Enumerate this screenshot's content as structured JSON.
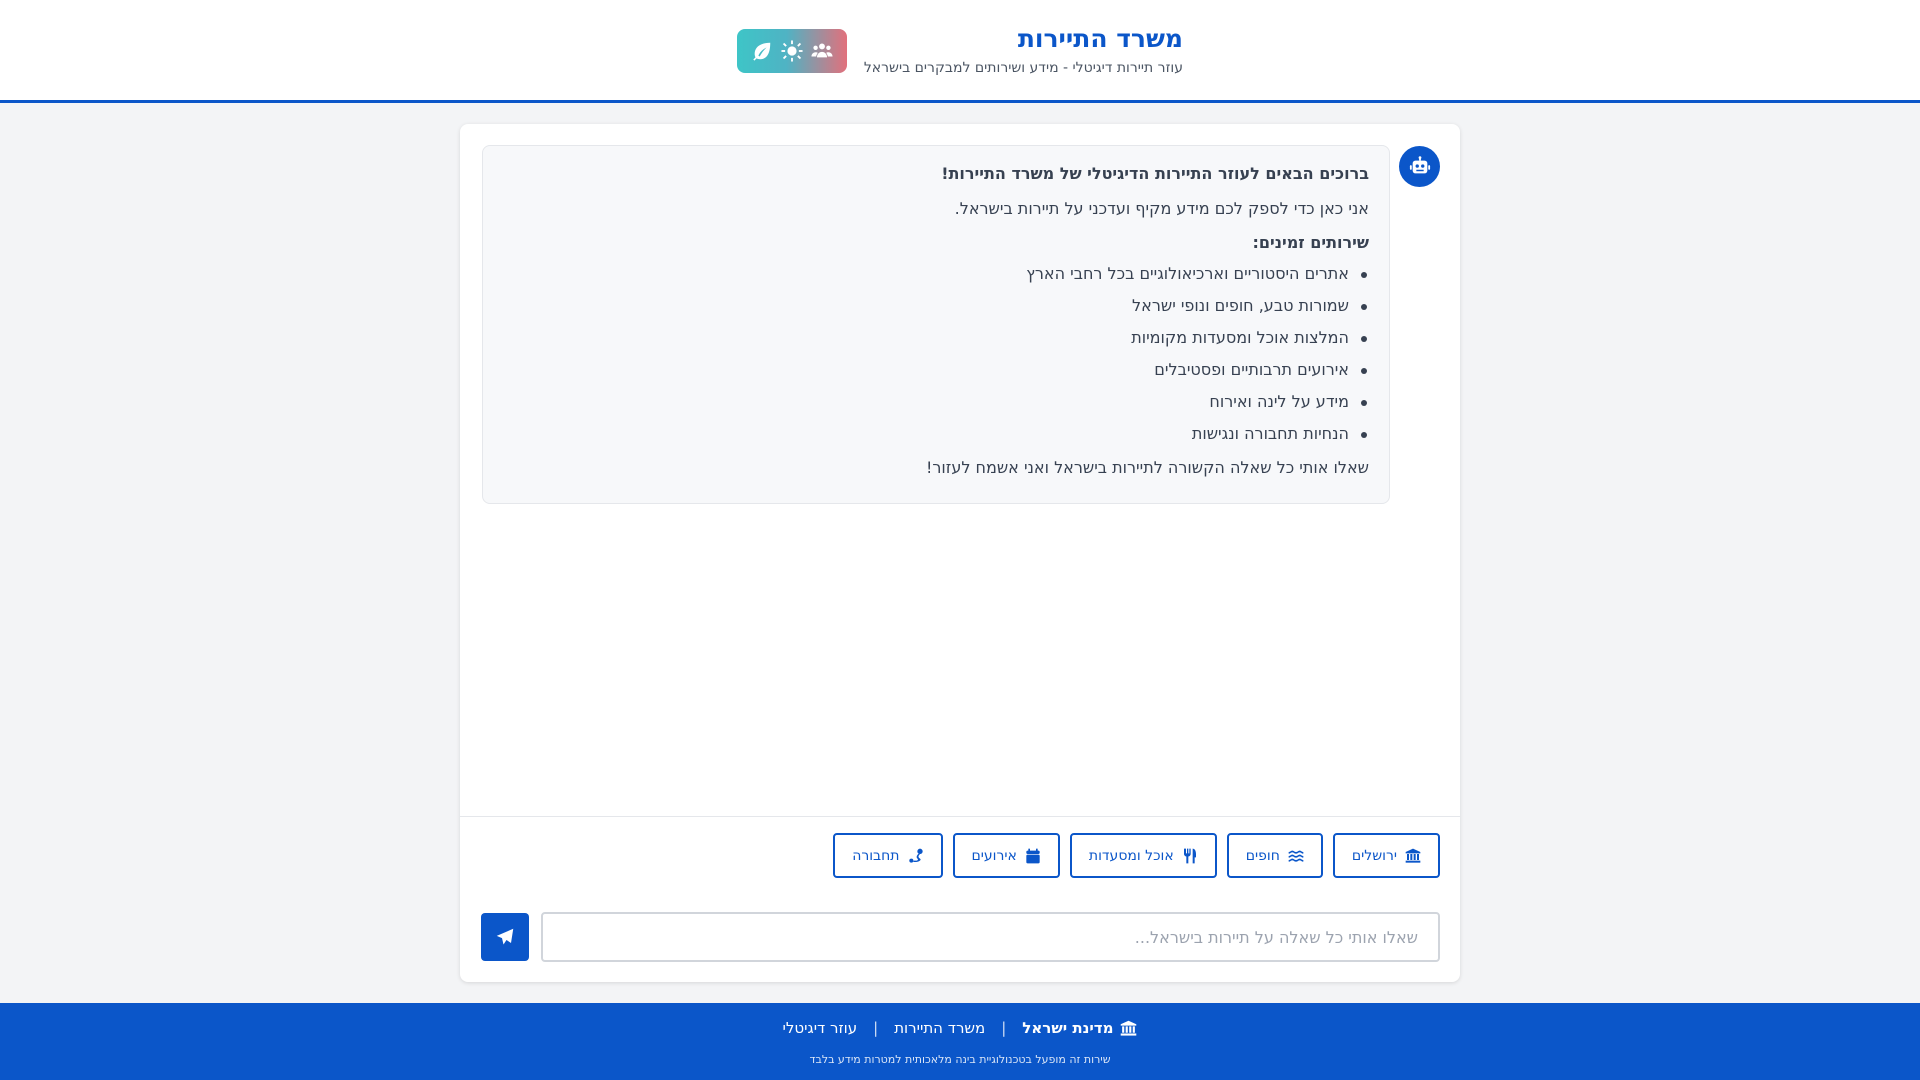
{
  "header": {
    "title": "משרד התיירות",
    "subtitle": "עוזר תיירות דיגיטלי - מידע ושירותים למבקרים בישראל",
    "logo_icons": [
      "people-icon",
      "sun-icon",
      "leaf-icon"
    ]
  },
  "chat": {
    "welcome": {
      "greeting": "ברוכים הבאים לעוזר התיירות הדיגיטלי של משרד התיירות!",
      "intro": "אני כאן כדי לספק לכם מידע מקיף ועדכני על תיירות בישראל.",
      "services_title": "שירותים זמינים:",
      "services": [
        "אתרים היסטוריים וארכיאולוגיים בכל רחבי הארץ",
        "שמורות טבע, חופים ונופי ישראל",
        "המלצות אוכל ומסעדות מקומיות",
        "אירועים תרבותיים ופסטיבלים",
        "מידע על לינה ואירוח",
        "הנחיות תחבורה ונגישות"
      ],
      "closing": "שאלו אותי כל שאלה הקשורה לתיירות בישראל ואני אשמח לעזור!"
    },
    "quick_actions": [
      {
        "label": "ירושלים",
        "icon": "landmark-icon"
      },
      {
        "label": "חופים",
        "icon": "waves-icon"
      },
      {
        "label": "אוכל ומסעדות",
        "icon": "utensils-icon"
      },
      {
        "label": "אירועים",
        "icon": "calendar-icon"
      },
      {
        "label": "תחבורה",
        "icon": "route-icon"
      }
    ],
    "input": {
      "placeholder": "שאלו אותי כל שאלה על תיירות בישראל...",
      "value": ""
    }
  },
  "footer": {
    "brand": "מדינת ישראל",
    "link1": "משרד התיירות",
    "link2": "עוזר דיגיטלי",
    "separator": "|",
    "note": "שירות זה מופעל בטכנולוגיית בינה מלאכותית למטרות מידע בלבד"
  },
  "colors": {
    "primary": "#0b56c9",
    "background": "#f3f4f6",
    "message_bg": "#f7f8fa"
  }
}
